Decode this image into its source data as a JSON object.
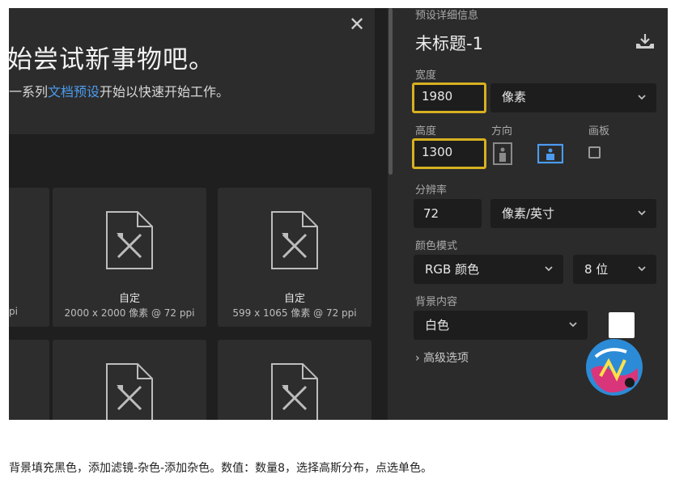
{
  "hero": {
    "title": "始尝试新事物吧。",
    "subtitle_pre": "一系列",
    "subtitle_link": "文档预设",
    "subtitle_post": "开始以快速开始工作。",
    "close": "✕"
  },
  "presets": [
    {
      "title": "",
      "meta": "pi"
    },
    {
      "title": "自定",
      "meta": "2000 x 2000 像素 @ 72 ppi"
    },
    {
      "title": "自定",
      "meta": "599 x 1065 像素 @ 72 ppi"
    }
  ],
  "panel": {
    "header": "预设详细信息",
    "doc_title": "未标题-1",
    "width_label": "宽度",
    "width_value": "1980",
    "width_unit": "像素",
    "height_label": "高度",
    "height_value": "1300",
    "orientation_label": "方向",
    "artboard_label": "画板",
    "resolution_label": "分辨率",
    "resolution_value": "72",
    "resolution_unit": "像素/英寸",
    "color_mode_label": "颜色模式",
    "color_mode_value": "RGB 颜色",
    "bit_depth_value": "8 位",
    "background_label": "背景内容",
    "background_value": "白色",
    "advanced_label": "高级选项"
  },
  "colors": {
    "accent_focus": "#d7b021",
    "accent_blue": "#4b9cf0",
    "swatch": "#ffffff"
  },
  "icons": [
    "close-icon",
    "save-preset-icon",
    "document-icon",
    "portrait-icon",
    "landscape-icon",
    "chevron-down-icon",
    "chevron-right-icon"
  ],
  "caption": "背景填充黑色，添加滤镜-杂色-添加杂色。数值：数量8，选择高斯分布，点选单色。"
}
